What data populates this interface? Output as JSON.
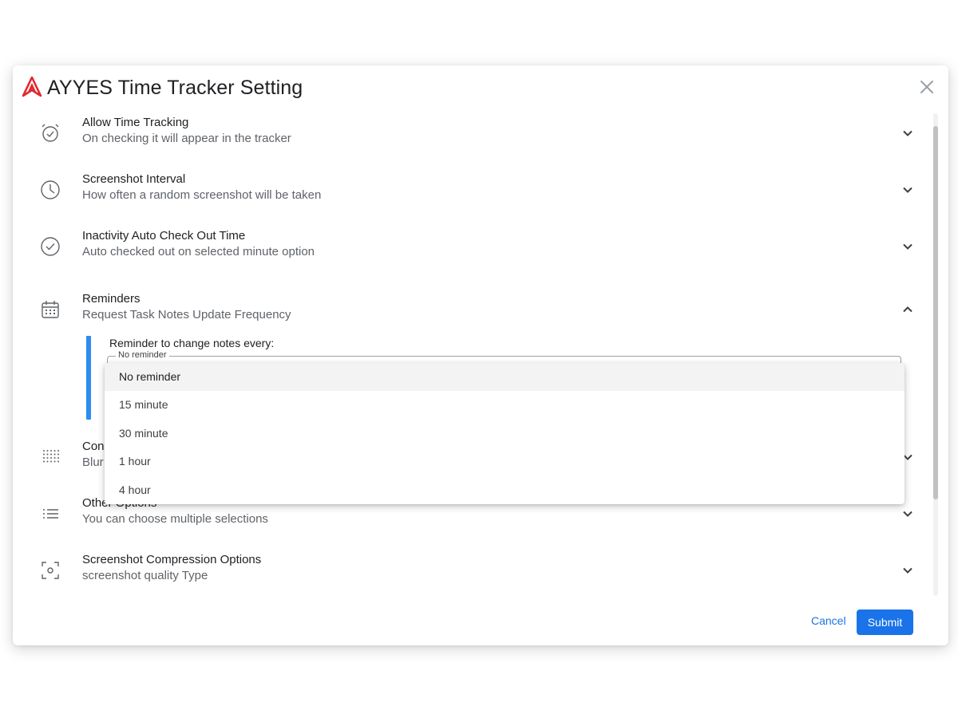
{
  "dialog": {
    "title": "AYYES Time Tracker Setting",
    "logo_icon": "ayyes-logo-icon",
    "close_icon": "close-icon",
    "brand_color": "#e5262e"
  },
  "settings": [
    {
      "title": "Allow Time Tracking",
      "subtitle": "On checking it will appear in the tracker",
      "icon": "alarm-check-icon",
      "expanded": false
    },
    {
      "title": "Screenshot Interval",
      "subtitle": "How often a random screenshot will be taken",
      "icon": "clock-icon",
      "expanded": false
    },
    {
      "title": "Inactivity Auto Check Out Time",
      "subtitle": "Auto checked out on selected minute option",
      "icon": "check-circle-icon",
      "expanded": false
    },
    {
      "title": "Reminders",
      "subtitle": "Request Task Notes Update Frequency",
      "icon": "calendar-icon",
      "expanded": true
    },
    {
      "title": "Con",
      "subtitle": "Blur",
      "icon": "dot-grid-icon",
      "expanded": false
    },
    {
      "title": "Other Options",
      "subtitle": "You can choose multiple selections",
      "icon": "list-icon",
      "expanded": false
    },
    {
      "title": "Screenshot Compression Options",
      "subtitle": "screenshot quality Type",
      "icon": "screenshot-frame-icon",
      "expanded": false
    }
  ],
  "reminder_panel": {
    "label": "Reminder to change notes every:",
    "select_legend": "No reminder",
    "selected_value": "No reminder",
    "accent_color": "#2d8cf0"
  },
  "dropdown": {
    "options": [
      "No reminder",
      "15 minute",
      "30 minute",
      "1 hour",
      "4 hour"
    ],
    "selected_index": 0
  },
  "footer": {
    "cancel_label": "Cancel",
    "submit_label": "Submit",
    "primary_color": "#1a73e8"
  }
}
